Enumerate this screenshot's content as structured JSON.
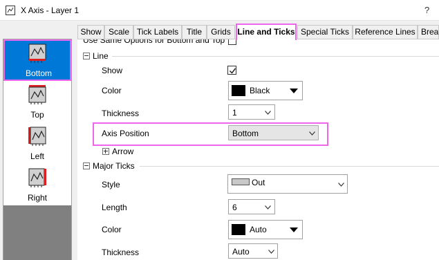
{
  "window": {
    "title": "X Axis - Layer 1",
    "help_label": "?"
  },
  "sidebar": {
    "items": [
      {
        "label": "Bottom",
        "selected": true
      },
      {
        "label": "Top",
        "selected": false
      },
      {
        "label": "Left",
        "selected": false
      },
      {
        "label": "Right",
        "selected": false
      }
    ]
  },
  "tabs": [
    {
      "label": "Show",
      "active": false
    },
    {
      "label": "Scale",
      "active": false
    },
    {
      "label": "Tick Labels",
      "active": false
    },
    {
      "label": "Title",
      "active": false
    },
    {
      "label": "Grids",
      "active": false
    },
    {
      "label": "Line and Ticks",
      "active": true
    },
    {
      "label": "Special Ticks",
      "active": false
    },
    {
      "label": "Reference Lines",
      "active": false
    },
    {
      "label": "Brea",
      "active": false
    }
  ],
  "panel": {
    "use_same_options_label": "Use Same Options for Bottom and Top",
    "line_section": {
      "title": "Line",
      "show_label": "Show",
      "show_checked": true,
      "color_label": "Color",
      "color_value": "Black",
      "thickness_label": "Thickness",
      "thickness_value": "1",
      "axis_position_label": "Axis Position",
      "axis_position_value": "Bottom",
      "arrow_label": "Arrow"
    },
    "major_ticks_section": {
      "title": "Major Ticks",
      "style_label": "Style",
      "style_value": "Out",
      "length_label": "Length",
      "length_value": "6",
      "color_label": "Color",
      "color_value": "Auto",
      "thickness_label": "Thickness",
      "thickness_value": "Auto"
    }
  },
  "colors": {
    "selection_blue": "#0078d7",
    "highlight_magenta": "#ee66ee",
    "swatch_black": "#000000"
  }
}
